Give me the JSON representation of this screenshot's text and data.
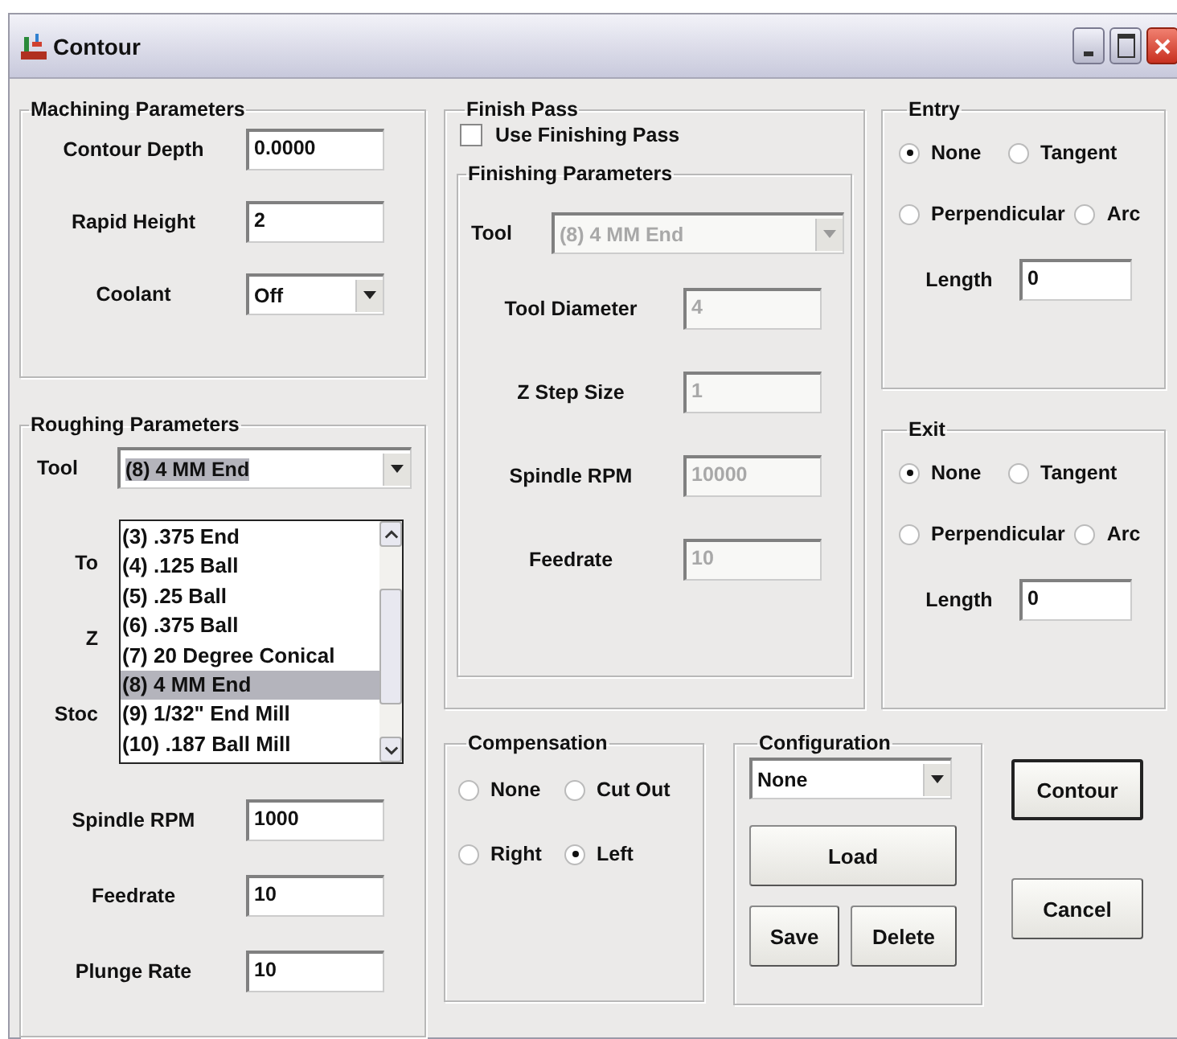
{
  "window": {
    "title": "Contour"
  },
  "machining_parameters": {
    "title": "Machining Parameters",
    "fields": [
      {
        "label": "Contour Depth",
        "value": "0.0000",
        "kind": "text"
      },
      {
        "label": "Rapid Height",
        "value": "2",
        "kind": "text"
      },
      {
        "label": "Coolant",
        "value": "Off",
        "kind": "dropdown"
      }
    ]
  },
  "roughing_parameters": {
    "title": "Roughing Parameters",
    "tool": {
      "label": "Tool",
      "value": "(8) 4 MM End"
    },
    "tool_list": [
      {
        "label": "(3) .375 End",
        "selected": false
      },
      {
        "label": "(4) .125 Ball",
        "selected": false
      },
      {
        "label": "(5) .25 Ball",
        "selected": false
      },
      {
        "label": "(6) .375 Ball",
        "selected": false
      },
      {
        "label": "(7) 20 Degree Conical",
        "selected": false
      },
      {
        "label": "(8) 4 MM End",
        "selected": true
      },
      {
        "label": "(9) 1/32\" End Mill",
        "selected": false
      },
      {
        "label": "(10) .187 Ball Mill",
        "selected": false
      }
    ],
    "fields": [
      {
        "label": "To",
        "kind": "covered"
      },
      {
        "label": "Z",
        "kind": "covered"
      },
      {
        "label": "Stoc",
        "kind": "covered"
      },
      {
        "label": "Spindle RPM",
        "value": "1000",
        "kind": "text"
      },
      {
        "label": "Feedrate",
        "value": "10",
        "kind": "text"
      },
      {
        "label": "Plunge Rate",
        "value": "10",
        "kind": "text"
      }
    ]
  },
  "finish_pass": {
    "title": "Finish Pass",
    "use_finishing_pass": {
      "label": "Use Finishing Pass",
      "checked": false
    },
    "finishing_parameters": {
      "title": "Finishing Parameters",
      "tool": {
        "label": "Tool",
        "value": "(8) 4 MM End",
        "disabled": true
      },
      "fields": [
        {
          "label": "Tool Diameter",
          "value": "4",
          "disabled": true
        },
        {
          "label": "Z Step Size",
          "value": "1",
          "disabled": true
        },
        {
          "label": "Spindle RPM",
          "value": "10000",
          "disabled": true
        },
        {
          "label": "Feedrate",
          "value": "10",
          "disabled": true
        }
      ]
    }
  },
  "entry": {
    "title": "Entry",
    "options": [
      {
        "label": "None",
        "selected": true
      },
      {
        "label": "Tangent",
        "selected": false
      },
      {
        "label": "Perpendicular",
        "selected": false
      },
      {
        "label": "Arc",
        "selected": false
      }
    ],
    "length": {
      "label": "Length",
      "value": "0"
    }
  },
  "exit": {
    "title": "Exit",
    "options": [
      {
        "label": "None",
        "selected": true
      },
      {
        "label": "Tangent",
        "selected": false
      },
      {
        "label": "Perpendicular",
        "selected": false
      },
      {
        "label": "Arc",
        "selected": false
      }
    ],
    "length": {
      "label": "Length",
      "value": "0"
    }
  },
  "compensation": {
    "title": "Compensation",
    "options": [
      {
        "label": "None",
        "selected": false
      },
      {
        "label": "Cut Out",
        "selected": false
      },
      {
        "label": "Right",
        "selected": false
      },
      {
        "label": "Left",
        "selected": true
      }
    ]
  },
  "configuration": {
    "title": "Configuration",
    "selection": "None",
    "buttons": [
      "Load",
      "Save",
      "Delete"
    ]
  },
  "buttons": [
    "Contour",
    "Cancel"
  ]
}
